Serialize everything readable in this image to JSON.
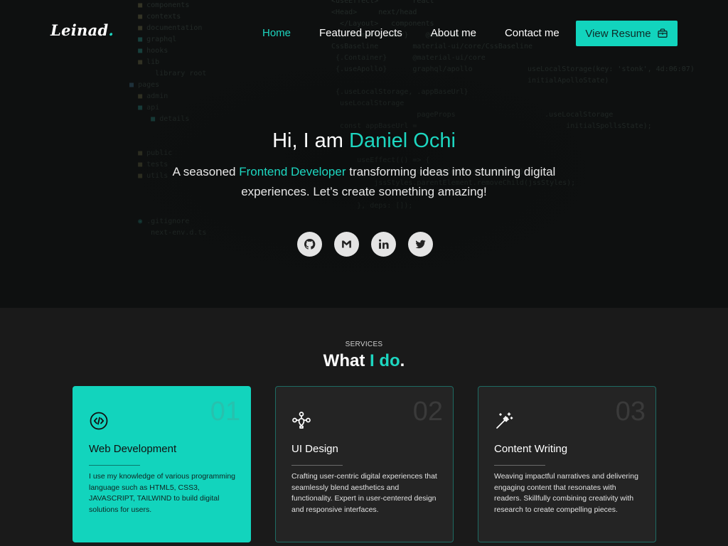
{
  "brand": {
    "name": "Leinad",
    "dot": "."
  },
  "nav": {
    "items": [
      "Home",
      "Featured projects",
      "About me",
      "Contact me"
    ],
    "active_index": 0
  },
  "resume_button": {
    "label": "View Resume",
    "icon": "briefcase-icon"
  },
  "hero": {
    "greeting": "Hi, I am ",
    "name": "Daniel Ochi",
    "sub_pre": "A seasoned ",
    "sub_highlight": "Frontend Developer",
    "sub_post": " transforming ideas into stunning digital experiences. Let’s create something amazing!"
  },
  "socials": [
    {
      "name": "github",
      "icon": "github-icon"
    },
    {
      "name": "gmail",
      "icon": "gmail-icon"
    },
    {
      "name": "linkedin",
      "icon": "linkedin-icon"
    },
    {
      "name": "twitter",
      "icon": "twitter-icon"
    }
  ],
  "services": {
    "label": "SERVICES",
    "title_pre": "What ",
    "title_highlight": "I do",
    "title_post": ".",
    "cards": [
      {
        "num": "01",
        "title": "Web Development",
        "icon": "code-icon",
        "active": true,
        "desc": "I use my knowledge of various programming language such as HTML5, CSS3, JAVASCRIPT, TAILWIND to build digital solutions for users."
      },
      {
        "num": "02",
        "title": "UI Design",
        "icon": "design-nodes-icon",
        "active": false,
        "desc": "Crafting user-centric digital experiences that seamlessly blend aesthetics and functionality. Expert in user-centered design and responsive interfaces."
      },
      {
        "num": "03",
        "title": "Content Writing",
        "icon": "magic-wand-icon",
        "active": false,
        "desc": "Weaving impactful narratives and delivering engaging content that resonates with readers. Skillfully combining creativity with research to create compelling pieces."
      }
    ]
  },
  "colors": {
    "accent": "#12d4bd",
    "background": "#1a1a1a",
    "hero_bg": "#0f1111",
    "card_bg": "#242424"
  }
}
